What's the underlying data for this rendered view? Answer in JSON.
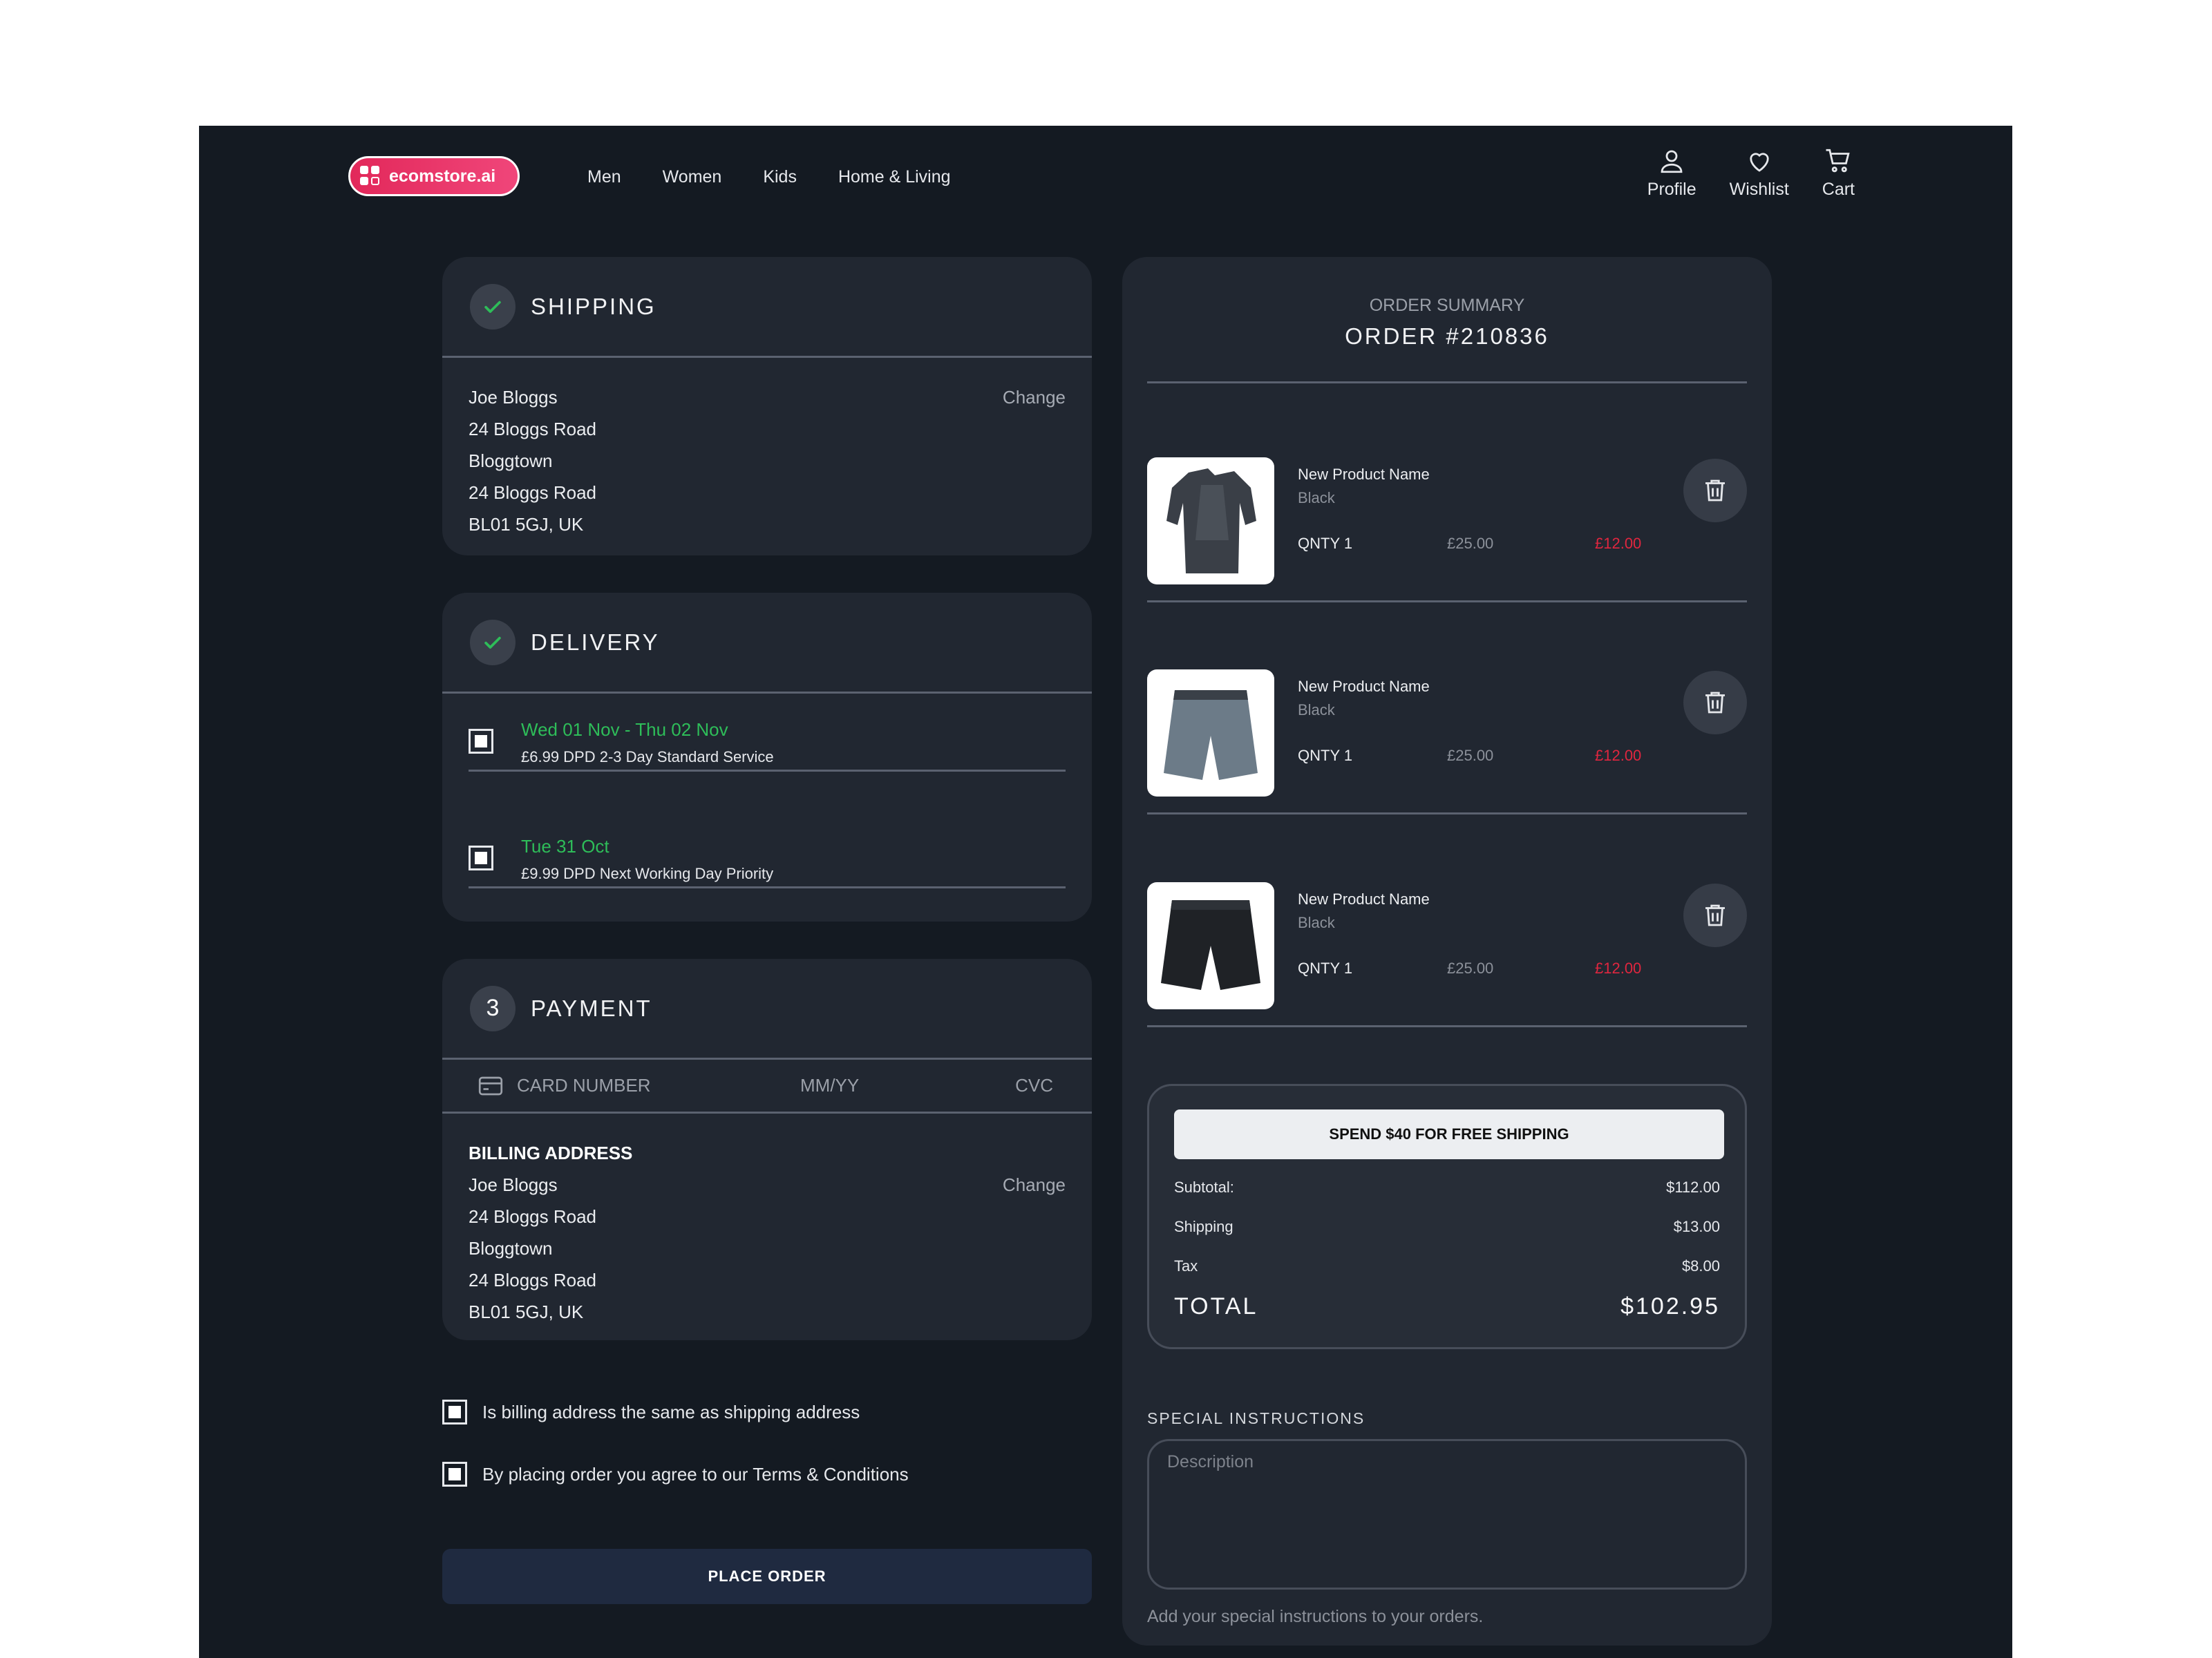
{
  "header": {
    "logo_text": "ecomstore.ai",
    "nav": [
      "Men",
      "Women",
      "Kids",
      "Home & Living"
    ],
    "actions": [
      {
        "label": "Profile",
        "icon": "user-icon"
      },
      {
        "label": "Wishlist",
        "icon": "heart-icon"
      },
      {
        "label": "Cart",
        "icon": "cart-icon"
      }
    ]
  },
  "shipping": {
    "title": "SHIPPING",
    "change": "Change",
    "address": [
      "Joe Bloggs",
      "24 Bloggs Road",
      "Bloggtown",
      "24 Bloggs Road",
      "BL01 5GJ, UK"
    ]
  },
  "delivery": {
    "title": "DELIVERY",
    "options": [
      {
        "date": "Wed 01 Nov - Thu 02 Nov",
        "desc": "£6.99 DPD 2-3 Day Standard Service"
      },
      {
        "date": "Tue 31 Oct",
        "desc": "£9.99 DPD Next Working Day Priority"
      }
    ]
  },
  "payment": {
    "step": "3",
    "title": "PAYMENT",
    "card_number": "CARD NUMBER",
    "expiry": "MM/YY",
    "cvc": "CVC",
    "billing_title": "BILLING ADDRESS",
    "change": "Change",
    "address": [
      "Joe Bloggs",
      "24 Bloggs Road",
      "Bloggtown",
      "24 Bloggs Road",
      "BL01 5GJ, UK"
    ]
  },
  "agreements": {
    "same_address": "Is billing address the same as shipping address",
    "terms": "By placing order you agree to our Terms & Conditions"
  },
  "place_order": "PLACE ORDER",
  "summary": {
    "label": "ORDER SUMMARY",
    "order_number": "ORDER #210836",
    "items": [
      {
        "name": "New Product Name",
        "color": "Black",
        "qty": "QNTY 1",
        "price": "£25.00",
        "sale": "£12.00"
      },
      {
        "name": "New Product Name",
        "color": "Black",
        "qty": "QNTY 1",
        "price": "£25.00",
        "sale": "£12.00"
      },
      {
        "name": "New Product Name",
        "color": "Black",
        "qty": "QNTY 1",
        "price": "£25.00",
        "sale": "£12.00"
      }
    ],
    "free_shipping": "SPEND $40 FOR FREE SHIPPING",
    "subtotal_label": "Subtotal:",
    "subtotal": "$112.00",
    "shipping_label": "Shipping",
    "shipping": "$13.00",
    "tax_label": "Tax",
    "tax": "$8.00",
    "total_label": "TOTAL",
    "total": "$102.95"
  },
  "special_instructions": {
    "label": "SPECIAL INSTRUCTIONS",
    "placeholder": "Description",
    "help": "Add your special instructions to your orders."
  },
  "colors": {
    "background": "#141a22",
    "card": "#212731",
    "accent_green": "#2ebd59",
    "sale_red": "#e0263f",
    "logo_pink": "#e2285a"
  }
}
